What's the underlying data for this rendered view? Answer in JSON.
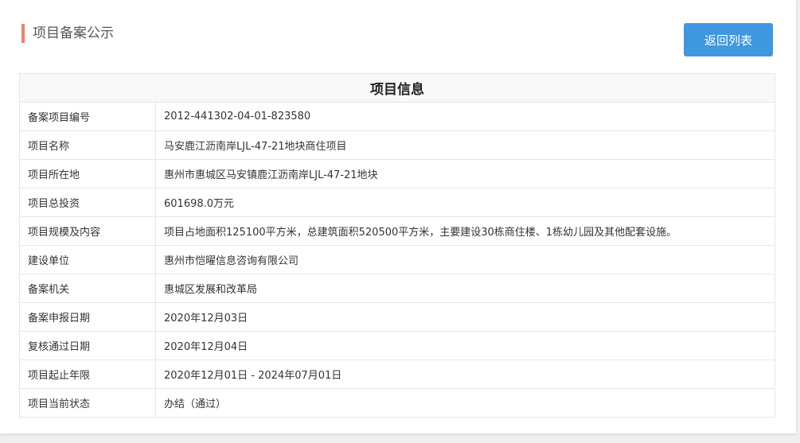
{
  "page_title": "项目备案公示",
  "back_button": "返回列表",
  "table_title": "项目信息",
  "rows": [
    {
      "label": "备案项目编号",
      "value": "2012-441302-04-01-823580"
    },
    {
      "label": "项目名称",
      "value": "马安鹿江沥南岸LJL-47-21地块商住项目"
    },
    {
      "label": "项目所在地",
      "value": "惠州市惠城区马安镇鹿江沥南岸LJL-47-21地块"
    },
    {
      "label": "项目总投资",
      "value": "601698.0万元"
    },
    {
      "label": "项目规模及内容",
      "value": "项目占地面积125100平方米，总建筑面积520500平方米，主要建设30栋商住楼、1栋幼儿园及其他配套设施。"
    },
    {
      "label": "建设单位",
      "value": "惠州市恺曜信息咨询有限公司"
    },
    {
      "label": "备案机关",
      "value": "惠城区发展和改革局"
    },
    {
      "label": "备案申报日期",
      "value": "2020年12月03日"
    },
    {
      "label": "复核通过日期",
      "value": "2020年12月04日"
    },
    {
      "label": "项目起止年限",
      "value": "2020年12月01日 - 2024年07月01日"
    },
    {
      "label": "项目当前状态",
      "value": "办结（通过）"
    }
  ]
}
